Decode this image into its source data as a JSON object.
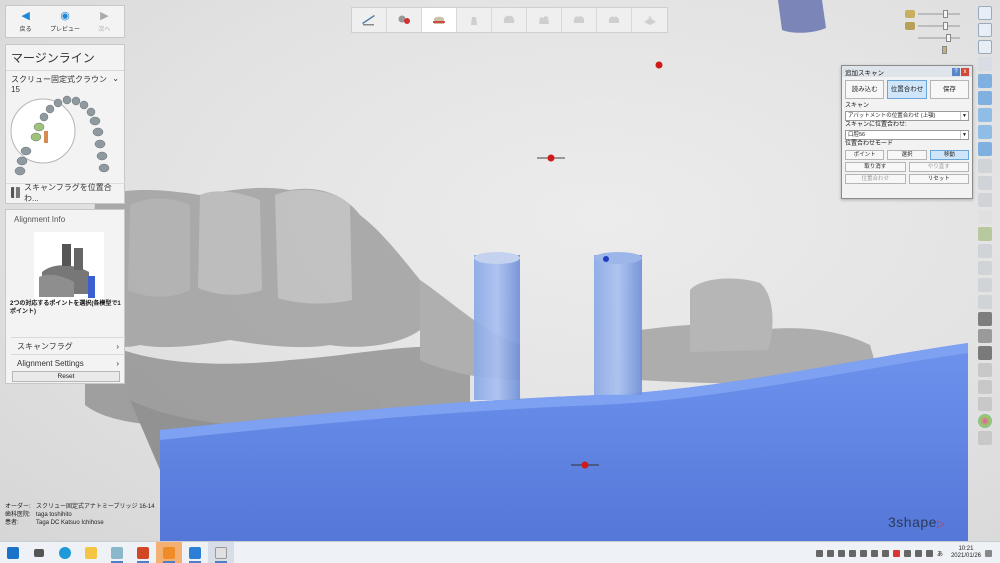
{
  "nav": {
    "back_label": "戻る",
    "preview_label": "プレビュー",
    "next_label": "次へ"
  },
  "left_panel": {
    "title": "マージンライン",
    "subtitle": "スクリュー固定式クラウン 15",
    "scan_flag_label": "スキャンフラグを位置合わ..."
  },
  "alignment_panel": {
    "title": "Alignment Info",
    "instruction": "2つの対応するポイントを選択(各模型で1ポイント)",
    "rows": [
      {
        "label": "スキャンフラグ"
      },
      {
        "label": "Alignment Settings"
      }
    ],
    "reset_label": "Reset"
  },
  "top_toolbar": {
    "items": [
      {
        "icon": "scan-edit-icon",
        "active": false
      },
      {
        "icon": "implant-icon",
        "active": false
      },
      {
        "icon": "margin-line-icon",
        "active": true
      },
      {
        "icon": "abutment-icon",
        "active": false
      },
      {
        "icon": "crown-icon",
        "active": false
      },
      {
        "icon": "tooth-design-icon",
        "active": false
      },
      {
        "icon": "tooth-sculpt-icon",
        "active": false
      },
      {
        "icon": "tooth-finish-icon",
        "active": false
      },
      {
        "icon": "model-icon",
        "active": false
      }
    ]
  },
  "dialog": {
    "title": "追加スキャン",
    "help_button": "?",
    "close_button": "x",
    "tabs": [
      {
        "label": "読み込む",
        "active": false
      },
      {
        "label": "位置合わせ",
        "active": true
      },
      {
        "label": "保存",
        "active": false
      }
    ],
    "scan_label": "スキャン",
    "scan_value": "アバットメントの位置合わせ (上顎)",
    "align_to_label": "スキャンに位置合わせ:",
    "align_to_value": "口腔56",
    "mode_label": "位置合わせモード",
    "mode_buttons": [
      {
        "label": "ポイント",
        "active": false
      },
      {
        "label": "選択",
        "active": false
      },
      {
        "label": "移動",
        "active": true
      }
    ],
    "undo_label": "取り消す",
    "redo_label": "やり直す",
    "align_label": "位置合わせ",
    "reset_label": "リセット"
  },
  "patient_info": {
    "order_label": "オーダー:",
    "order_value": "スクリュー固定式アナトミーブリッジ 16-14",
    "clinic_label": "歯科医院:",
    "clinic_value": "taga toshihito",
    "patient_label": "患者:",
    "patient_value": "Taga DC Katsuo Ichihose"
  },
  "brand": {
    "logo_text": "3shape",
    "accent": "#d33030"
  },
  "colors": {
    "accent_blue": "#1e88d8",
    "scan_blue": "#5b87e8",
    "marker_red": "#d01a1a"
  },
  "taskbar": {
    "apps": [
      {
        "name": "start-icon",
        "color": "#1a73c8",
        "running": false
      },
      {
        "name": "task-view-icon",
        "color": "#444444",
        "running": false
      },
      {
        "name": "edge-icon",
        "color": "#1f9ad6",
        "running": false
      },
      {
        "name": "file-explorer-icon",
        "color": "#f4c542",
        "running": false
      },
      {
        "name": "dental-app-icon",
        "color": "#8ab7c9",
        "running": true
      },
      {
        "name": "powerpoint-icon",
        "color": "#d24726",
        "running": true
      },
      {
        "name": "workflow-icon",
        "color": "#f08c28",
        "running": true
      },
      {
        "name": "3shape-icon",
        "color": "#2b7fd6",
        "running": true
      },
      {
        "name": "dental-designer-icon",
        "color": "#e0e0e0",
        "running": true
      }
    ],
    "time": "10:21",
    "date": "2021/01/26",
    "ime_label": "あ"
  }
}
